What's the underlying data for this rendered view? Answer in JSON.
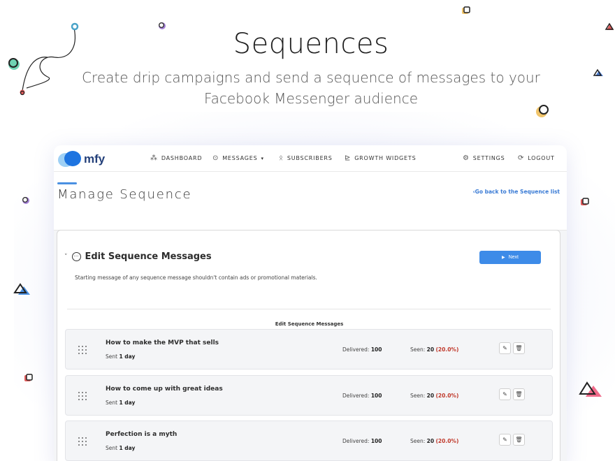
{
  "hero": {
    "title": "Sequences",
    "subtitle": "Create drip campaigns and send a sequence of messages to your Facebook Messenger audience"
  },
  "app": {
    "logo_text": "mfy",
    "nav": {
      "dashboard": "DASHBOARD",
      "messages": "MESSAGES",
      "subscribers": "SUBSCRIBERS",
      "growth_widgets": "GROWTH WIDGETS",
      "settings": "SETTINGS",
      "logout": "LOGOUT"
    },
    "page_title": "Manage Sequence",
    "back_link": "Go back to the Sequence list",
    "section": {
      "title": "Edit Sequence Messages",
      "next_label": "Next",
      "warning": "Starting message of any sequence message shouldn't contain ads or promotional materials.",
      "list_title": "Edit Sequence Messages"
    },
    "messages": [
      {
        "title": "How to make the MVP that sells",
        "sent_prefix": "Sent",
        "sent_value": "1 day",
        "delivered_label": "Delivered:",
        "delivered": "100",
        "seen_label": "Seen:",
        "seen": "20",
        "seen_pct": "(20.0%)"
      },
      {
        "title": "How to come up with great ideas",
        "sent_prefix": "Sent",
        "sent_value": "1 day",
        "delivered_label": "Delivered:",
        "delivered": "100",
        "seen_label": "Seen:",
        "seen": "20",
        "seen_pct": "(20.0%)"
      },
      {
        "title": "Perfection is a myth",
        "sent_prefix": "Sent",
        "sent_value": "1 day",
        "delivered_label": "Delivered:",
        "delivered": "100",
        "seen_label": "Seen:",
        "seen": "20",
        "seen_pct": "(20.0%)"
      }
    ]
  },
  "colors": {
    "accent": "#3d8be8",
    "link": "#3a7bd5",
    "percent": "#c0392b",
    "logo": "#24407a"
  },
  "icons": [
    "dashboard-icon",
    "chat-icon",
    "subscribers-icon",
    "chart-icon",
    "gear-icon",
    "logout-icon",
    "drag-handle-icon",
    "edit-icon",
    "trash-icon"
  ]
}
